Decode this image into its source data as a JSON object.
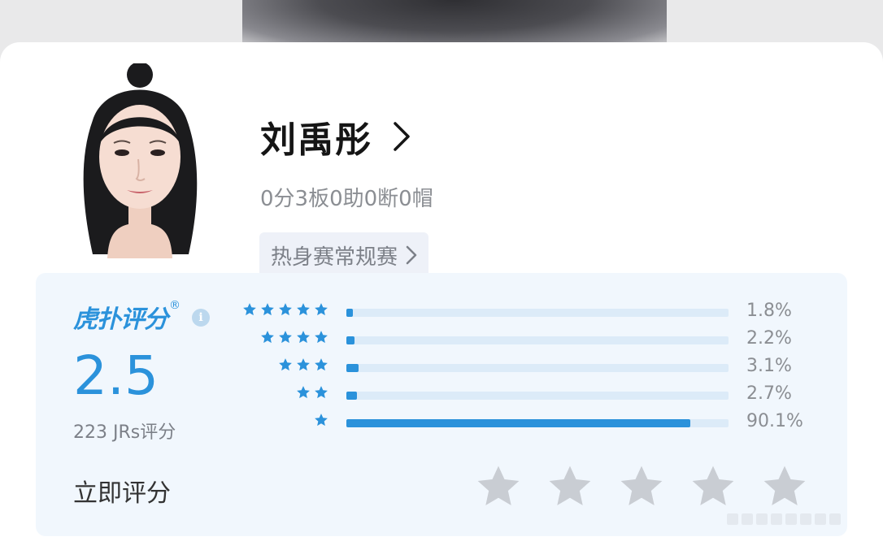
{
  "player": {
    "name": "刘禹彤",
    "stats": "0分3板0助0断0帽",
    "game_type": "热身赛常规赛"
  },
  "rating": {
    "brand": "虎扑评分",
    "registered_mark": "®",
    "info_icon": "i",
    "score": "2.5",
    "raters": "223 JRs评分",
    "rate_now_label": "立即评分",
    "distribution": [
      {
        "stars": 5,
        "percent_label": "1.8%",
        "percent": 1.8
      },
      {
        "stars": 4,
        "percent_label": "2.2%",
        "percent": 2.2
      },
      {
        "stars": 3,
        "percent_label": "3.1%",
        "percent": 3.1
      },
      {
        "stars": 2,
        "percent_label": "2.7%",
        "percent": 2.7
      },
      {
        "stars": 1,
        "percent_label": "90.1%",
        "percent": 90.1
      }
    ],
    "user_rating_stars": 0
  },
  "colors": {
    "accent": "#2b92db",
    "bar_track": "#dcebf8",
    "panel_bg": "#f1f7fd",
    "empty_star": "#c9cdd3"
  },
  "icons": {
    "name_link": "chevron-right-icon",
    "tag_link": "chevron-right-icon",
    "info": "info-icon",
    "star": "star-icon"
  }
}
